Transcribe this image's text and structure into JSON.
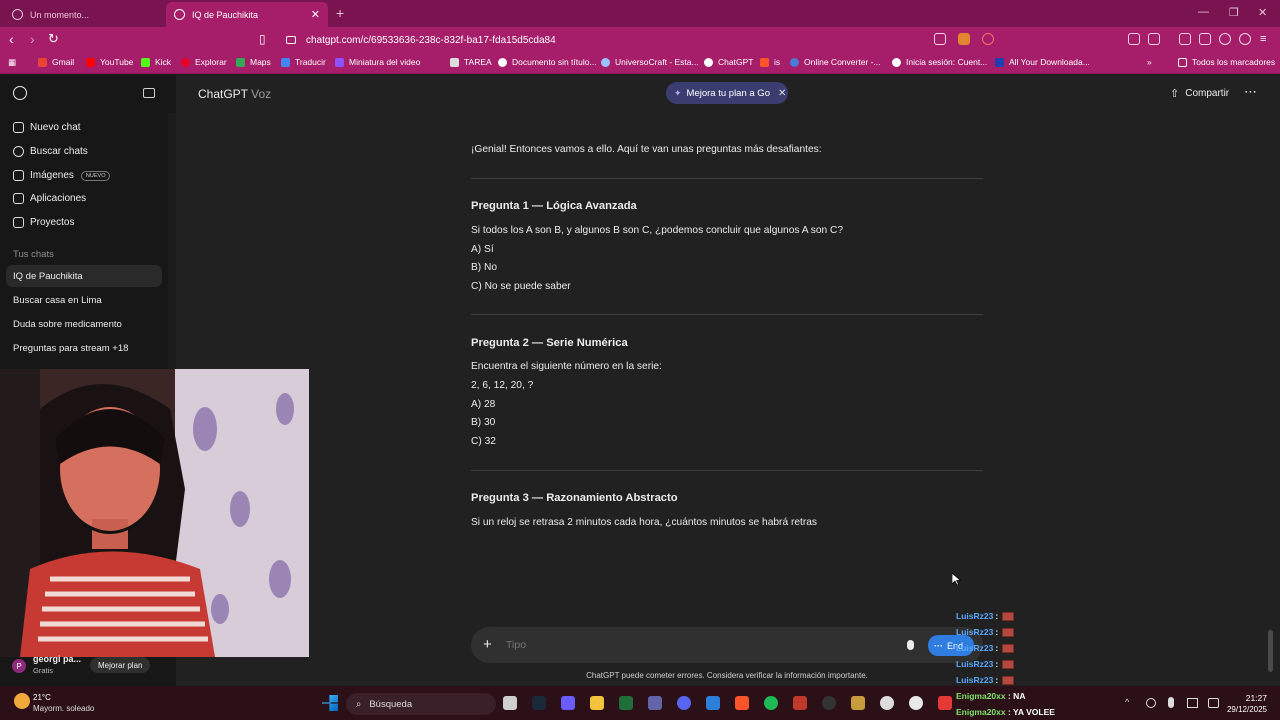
{
  "browser": {
    "tabs": [
      {
        "label": "Un momento..."
      },
      {
        "label": "IQ de Pauchikita"
      }
    ],
    "url": "chatgpt.com/c/69533636-238c-832f-ba17-fda15d5cda84",
    "bookmarks": [
      "Gmail",
      "YouTube",
      "Kick",
      "Explorar",
      "Maps",
      "Traducir",
      "Miniatura del video",
      "TAREA",
      "Documento sin título...",
      "UniversoCraft - Esta...",
      "ChatGPT",
      "is",
      "Online Converter -...",
      "Inicia sesión: Cuent...",
      "All Your Downloada..."
    ],
    "all_bookmarks": "Todos los marcadores"
  },
  "sidebar": {
    "nav": [
      {
        "label": "Nuevo chat"
      },
      {
        "label": "Buscar chats"
      },
      {
        "label": "Imágenes",
        "badge": "NUEVO"
      },
      {
        "label": "Aplicaciones"
      },
      {
        "label": "Proyectos"
      }
    ],
    "section_title": "Tus chats",
    "chats": [
      {
        "label": "IQ de Pauchikita",
        "active": true
      },
      {
        "label": "Buscar casa en Lima"
      },
      {
        "label": "Duda sobre medicamento"
      },
      {
        "label": "Preguntas para stream +18"
      }
    ],
    "profile": {
      "initial": "P",
      "name": "georgi pa...",
      "plan": "Gratis",
      "upgrade": "Mejorar plan"
    }
  },
  "header": {
    "title": "ChatGPT",
    "subtitle": "Voz",
    "upgrade_pill": "Mejora tu plan a Go",
    "share": "Compartir"
  },
  "conversation": {
    "intro": "¡Genial! Entonces vamos a ello. Aquí te van unas preguntas más desafiantes:",
    "q1_title": "Pregunta 1 — Lógica Avanzada",
    "q1_text": "Si todos los A son B, y algunos B son C, ¿podemos concluir que algunos A son C?",
    "q1_options": [
      "A) Sí",
      "B) No",
      "C) No se puede saber"
    ],
    "q2_title": "Pregunta 2 — Serie Numérica",
    "q2_text": "Encuentra el siguiente número en la serie:",
    "q2_series": "2, 6, 12, 20, ?",
    "q2_options": [
      "A) 28",
      "B) 30",
      "C) 32"
    ],
    "q3_title": "Pregunta 3 — Razonamiento Abstracto",
    "q3_text": "Si un reloj se retrasa 2 minutos cada hora, ¿cuántos minutos se habrá retras"
  },
  "composer": {
    "placeholder": "Tipo",
    "voice_label": "End",
    "disclaimer": "ChatGPT puede cometer errores. Considera verificar la información importante."
  },
  "stream_chat": [
    {
      "user": "LuisRz23",
      "sep": ":"
    },
    {
      "user": "LuisRz23",
      "sep": ":"
    },
    {
      "user": "LuisRz23",
      "sep": ":"
    },
    {
      "user": "LuisRz23",
      "sep": ":"
    },
    {
      "user": "LuisRz23",
      "sep": ":"
    },
    {
      "user": "Enigma20xx",
      "text": " : NA"
    },
    {
      "user": "Enigma20xx",
      "text": " : YA VOLEE"
    }
  ],
  "taskbar": {
    "weather_temp": "21°C",
    "weather_desc": "Mayorm. soleado",
    "search": "Búsqueda",
    "time": "21:27",
    "date": "29/12/2025"
  },
  "colors": {
    "tab_bar": "#7a1450",
    "address_bar": "#a61d6a",
    "sidebar": "#171717",
    "main": "#212121",
    "accent_blue": "#2f7de1"
  }
}
